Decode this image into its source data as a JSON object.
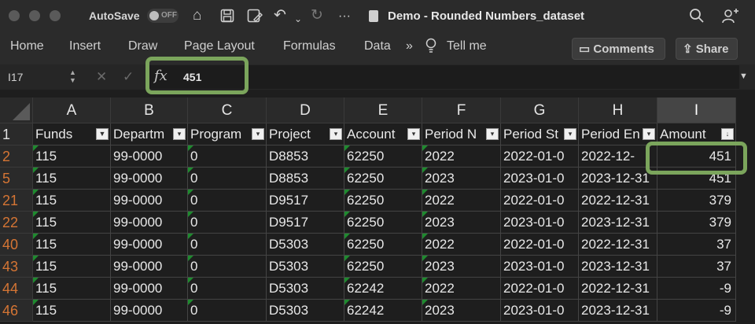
{
  "titlebar": {
    "autosave_label": "AutoSave",
    "autosave_state": "OFF",
    "more_label": "···",
    "document_title": "Demo - Rounded Numbers_dataset"
  },
  "ribbon": {
    "tabs": [
      "Home",
      "Insert",
      "Draw",
      "Page Layout",
      "Formulas",
      "Data",
      "Tell me"
    ],
    "overflow": "»",
    "comments_label": "Comments",
    "share_label": "Share"
  },
  "formula_bar": {
    "cell_ref": "I17",
    "fx_label": "fx",
    "value": "451"
  },
  "sheet": {
    "columns": [
      "A",
      "B",
      "C",
      "D",
      "E",
      "F",
      "G",
      "H",
      "I"
    ],
    "selected_column": "I",
    "header_row_number": "1",
    "headers": [
      "Funds",
      "Departm",
      "Program",
      "Project",
      "Account",
      "Period N",
      "Period St",
      "Period En",
      "Amount"
    ],
    "rows": [
      {
        "num": "2",
        "cells": [
          "115",
          "99-0000",
          "0",
          "D8853",
          "62250",
          "2022",
          "2022-01-0",
          "2022-12-",
          "451"
        ]
      },
      {
        "num": "5",
        "cells": [
          "115",
          "99-0000",
          "0",
          "D8853",
          "62250",
          "2023",
          "2023-01-0",
          "2023-12-31",
          "451"
        ]
      },
      {
        "num": "21",
        "cells": [
          "115",
          "99-0000",
          "0",
          "D9517",
          "62250",
          "2022",
          "2022-01-0",
          "2022-12-31",
          "379"
        ]
      },
      {
        "num": "22",
        "cells": [
          "115",
          "99-0000",
          "0",
          "D9517",
          "62250",
          "2023",
          "2023-01-0",
          "2023-12-31",
          "379"
        ]
      },
      {
        "num": "40",
        "cells": [
          "115",
          "99-0000",
          "0",
          "D5303",
          "62250",
          "2022",
          "2022-01-0",
          "2022-12-31",
          "37"
        ]
      },
      {
        "num": "43",
        "cells": [
          "115",
          "99-0000",
          "0",
          "D5303",
          "62250",
          "2023",
          "2023-01-0",
          "2023-12-31",
          "37"
        ]
      },
      {
        "num": "44",
        "cells": [
          "115",
          "99-0000",
          "0",
          "D5303",
          "62242",
          "2022",
          "2022-01-0",
          "2022-12-31",
          "-9"
        ]
      },
      {
        "num": "46",
        "cells": [
          "115",
          "99-0000",
          "0",
          "D5303",
          "62242",
          "2023",
          "2023-01-0",
          "2023-12-31",
          "-9"
        ]
      }
    ]
  },
  "colors": {
    "highlight": "#7ba55c",
    "row_number": "#d57534",
    "text_marker": "#1f8a2f"
  }
}
